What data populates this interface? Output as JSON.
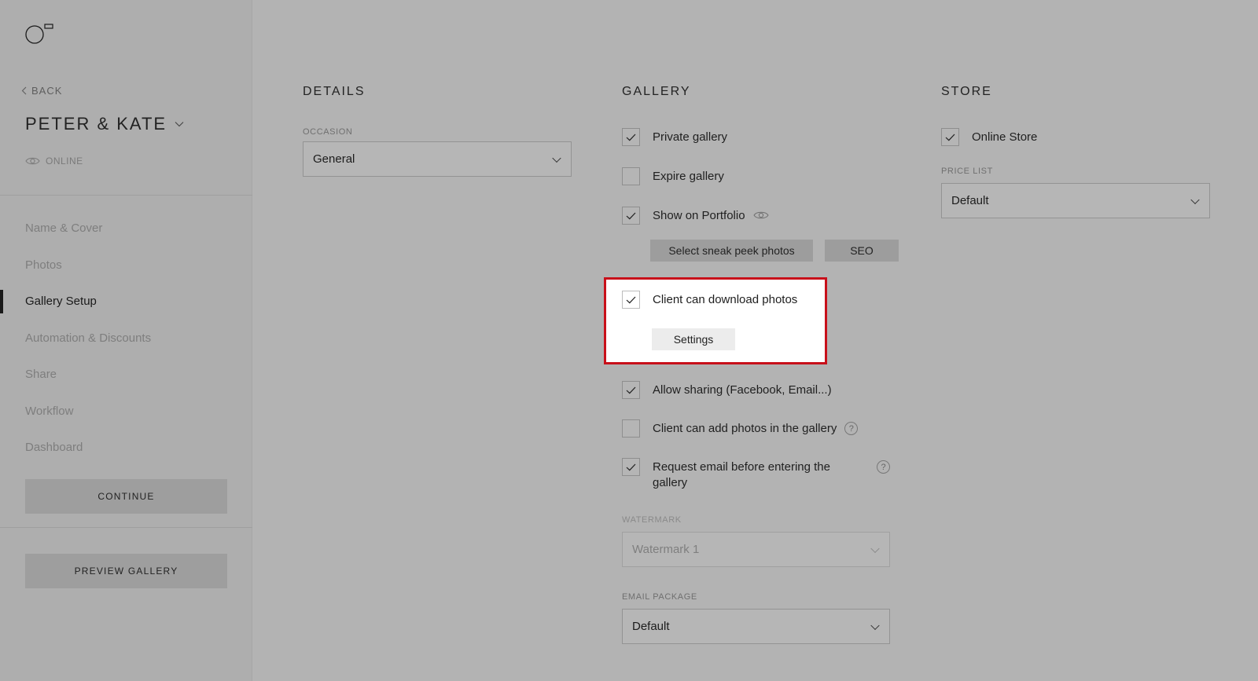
{
  "sidebar": {
    "back_label": "BACK",
    "client_name": "PETER & KATE",
    "status_label": "ONLINE",
    "nav_items": [
      {
        "label": "Name & Cover"
      },
      {
        "label": "Photos"
      },
      {
        "label": "Gallery Setup"
      },
      {
        "label": "Automation & Discounts"
      },
      {
        "label": "Share"
      },
      {
        "label": "Workflow"
      },
      {
        "label": "Dashboard"
      }
    ],
    "active_nav": "Gallery Setup",
    "continue_label": "CONTINUE",
    "preview_label": "PREVIEW GALLERY"
  },
  "details": {
    "title": "DETAILS",
    "occasion_label": "OCCASION",
    "occasion_value": "General"
  },
  "gallery": {
    "title": "GALLERY",
    "private_gallery": {
      "label": "Private gallery",
      "checked": true
    },
    "expire_gallery": {
      "label": "Expire gallery",
      "checked": false
    },
    "show_on_portfolio": {
      "label": "Show on Portfolio",
      "checked": true
    },
    "sneak_peek_button": "Select sneak peek photos",
    "seo_button": "SEO",
    "client_download": {
      "label": "Client can download photos",
      "checked": true
    },
    "settings_button": "Settings",
    "allow_sharing": {
      "label": "Allow sharing (Facebook, Email...)",
      "checked": true
    },
    "client_add_photos": {
      "label": "Client can add photos in the gallery",
      "checked": false
    },
    "request_email": {
      "label_line1": "Request email before entering the",
      "label_line2": "gallery",
      "checked": true
    },
    "watermark_label": "WATERMARK",
    "watermark_value": "Watermark 1",
    "email_package_label": "EMAIL PACKAGE",
    "email_package_value": "Default"
  },
  "store": {
    "title": "STORE",
    "online_store": {
      "label": "Online Store",
      "checked": true
    },
    "price_list_label": "PRICE LIST",
    "price_list_value": "Default"
  },
  "colors": {
    "highlight_border": "#c8101a",
    "overlay_gray": "#b3b3b3"
  }
}
